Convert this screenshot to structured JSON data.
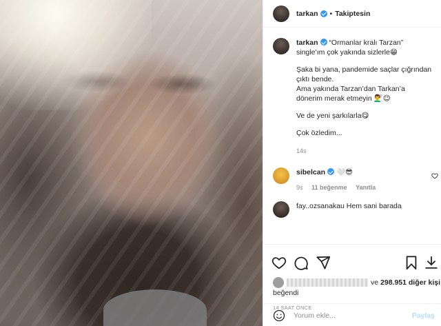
{
  "post": {
    "username": "tarkan",
    "follow_status": "Takiptesin",
    "dot": "•"
  },
  "caption": {
    "username": "tarkan",
    "line1": "“Ormanlar kralı Tarzan”",
    "line2": "single’ım çok yakında sizlerle😁",
    "para2a": "Şaka bi yana, pandemide saçlar çığrından",
    "para2b": "çıktı bende.",
    "para2c": "Ama yakında Tarzan’dan Tarkan’a",
    "para2d": "dönerim merak etmeyin 💇‍♂️😉",
    "para3": "Ve de yeni şarkılarla😋",
    "para4": "Çok özledim...",
    "time": "14s"
  },
  "comments": [
    {
      "username": "sibelcan",
      "text": "🤍😎",
      "time": "9s",
      "likes": "11 beğenme",
      "reply": "Yanıtla"
    },
    {
      "partial_text": "fay..ozsanakau Hem sani barada"
    }
  ],
  "likes": {
    "text_prefix": "ve",
    "count": "298.951 diğer kişi",
    "liked_label": "beğendi"
  },
  "date": "14 SAAT ÖNCE",
  "comment_input": {
    "placeholder": "Yorum ekle..."
  },
  "share_label": "Paylaş",
  "icons": {
    "like": "heart-icon",
    "comment": "comment-icon",
    "share": "send-icon",
    "save": "bookmark-icon",
    "emoji": "smiley-icon"
  },
  "colors": {
    "verified": "#3897f0",
    "muted": "#8e8e8e",
    "share_disabled": "#b2dffc",
    "text": "#262626"
  }
}
